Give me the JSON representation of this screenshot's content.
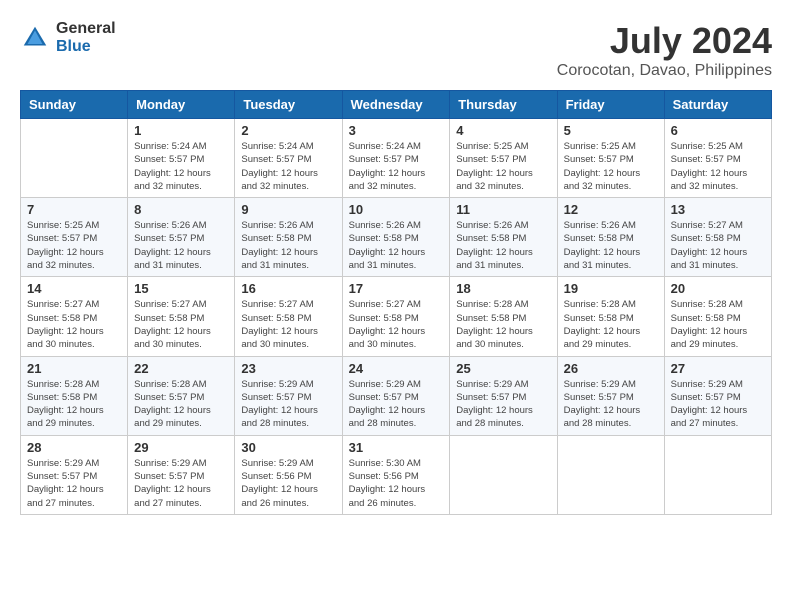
{
  "header": {
    "logo_general": "General",
    "logo_blue": "Blue",
    "main_title": "July 2024",
    "subtitle": "Corocotan, Davao, Philippines"
  },
  "weekdays": [
    "Sunday",
    "Monday",
    "Tuesday",
    "Wednesday",
    "Thursday",
    "Friday",
    "Saturday"
  ],
  "weeks": [
    [
      {
        "day": "",
        "info": ""
      },
      {
        "day": "1",
        "info": "Sunrise: 5:24 AM\nSunset: 5:57 PM\nDaylight: 12 hours\nand 32 minutes."
      },
      {
        "day": "2",
        "info": "Sunrise: 5:24 AM\nSunset: 5:57 PM\nDaylight: 12 hours\nand 32 minutes."
      },
      {
        "day": "3",
        "info": "Sunrise: 5:24 AM\nSunset: 5:57 PM\nDaylight: 12 hours\nand 32 minutes."
      },
      {
        "day": "4",
        "info": "Sunrise: 5:25 AM\nSunset: 5:57 PM\nDaylight: 12 hours\nand 32 minutes."
      },
      {
        "day": "5",
        "info": "Sunrise: 5:25 AM\nSunset: 5:57 PM\nDaylight: 12 hours\nand 32 minutes."
      },
      {
        "day": "6",
        "info": "Sunrise: 5:25 AM\nSunset: 5:57 PM\nDaylight: 12 hours\nand 32 minutes."
      }
    ],
    [
      {
        "day": "7",
        "info": "Sunrise: 5:25 AM\nSunset: 5:57 PM\nDaylight: 12 hours\nand 32 minutes."
      },
      {
        "day": "8",
        "info": "Sunrise: 5:26 AM\nSunset: 5:57 PM\nDaylight: 12 hours\nand 31 minutes."
      },
      {
        "day": "9",
        "info": "Sunrise: 5:26 AM\nSunset: 5:58 PM\nDaylight: 12 hours\nand 31 minutes."
      },
      {
        "day": "10",
        "info": "Sunrise: 5:26 AM\nSunset: 5:58 PM\nDaylight: 12 hours\nand 31 minutes."
      },
      {
        "day": "11",
        "info": "Sunrise: 5:26 AM\nSunset: 5:58 PM\nDaylight: 12 hours\nand 31 minutes."
      },
      {
        "day": "12",
        "info": "Sunrise: 5:26 AM\nSunset: 5:58 PM\nDaylight: 12 hours\nand 31 minutes."
      },
      {
        "day": "13",
        "info": "Sunrise: 5:27 AM\nSunset: 5:58 PM\nDaylight: 12 hours\nand 31 minutes."
      }
    ],
    [
      {
        "day": "14",
        "info": "Sunrise: 5:27 AM\nSunset: 5:58 PM\nDaylight: 12 hours\nand 30 minutes."
      },
      {
        "day": "15",
        "info": "Sunrise: 5:27 AM\nSunset: 5:58 PM\nDaylight: 12 hours\nand 30 minutes."
      },
      {
        "day": "16",
        "info": "Sunrise: 5:27 AM\nSunset: 5:58 PM\nDaylight: 12 hours\nand 30 minutes."
      },
      {
        "day": "17",
        "info": "Sunrise: 5:27 AM\nSunset: 5:58 PM\nDaylight: 12 hours\nand 30 minutes."
      },
      {
        "day": "18",
        "info": "Sunrise: 5:28 AM\nSunset: 5:58 PM\nDaylight: 12 hours\nand 30 minutes."
      },
      {
        "day": "19",
        "info": "Sunrise: 5:28 AM\nSunset: 5:58 PM\nDaylight: 12 hours\nand 29 minutes."
      },
      {
        "day": "20",
        "info": "Sunrise: 5:28 AM\nSunset: 5:58 PM\nDaylight: 12 hours\nand 29 minutes."
      }
    ],
    [
      {
        "day": "21",
        "info": "Sunrise: 5:28 AM\nSunset: 5:58 PM\nDaylight: 12 hours\nand 29 minutes."
      },
      {
        "day": "22",
        "info": "Sunrise: 5:28 AM\nSunset: 5:57 PM\nDaylight: 12 hours\nand 29 minutes."
      },
      {
        "day": "23",
        "info": "Sunrise: 5:29 AM\nSunset: 5:57 PM\nDaylight: 12 hours\nand 28 minutes."
      },
      {
        "day": "24",
        "info": "Sunrise: 5:29 AM\nSunset: 5:57 PM\nDaylight: 12 hours\nand 28 minutes."
      },
      {
        "day": "25",
        "info": "Sunrise: 5:29 AM\nSunset: 5:57 PM\nDaylight: 12 hours\nand 28 minutes."
      },
      {
        "day": "26",
        "info": "Sunrise: 5:29 AM\nSunset: 5:57 PM\nDaylight: 12 hours\nand 28 minutes."
      },
      {
        "day": "27",
        "info": "Sunrise: 5:29 AM\nSunset: 5:57 PM\nDaylight: 12 hours\nand 27 minutes."
      }
    ],
    [
      {
        "day": "28",
        "info": "Sunrise: 5:29 AM\nSunset: 5:57 PM\nDaylight: 12 hours\nand 27 minutes."
      },
      {
        "day": "29",
        "info": "Sunrise: 5:29 AM\nSunset: 5:57 PM\nDaylight: 12 hours\nand 27 minutes."
      },
      {
        "day": "30",
        "info": "Sunrise: 5:29 AM\nSunset: 5:56 PM\nDaylight: 12 hours\nand 26 minutes."
      },
      {
        "day": "31",
        "info": "Sunrise: 5:30 AM\nSunset: 5:56 PM\nDaylight: 12 hours\nand 26 minutes."
      },
      {
        "day": "",
        "info": ""
      },
      {
        "day": "",
        "info": ""
      },
      {
        "day": "",
        "info": ""
      }
    ]
  ]
}
